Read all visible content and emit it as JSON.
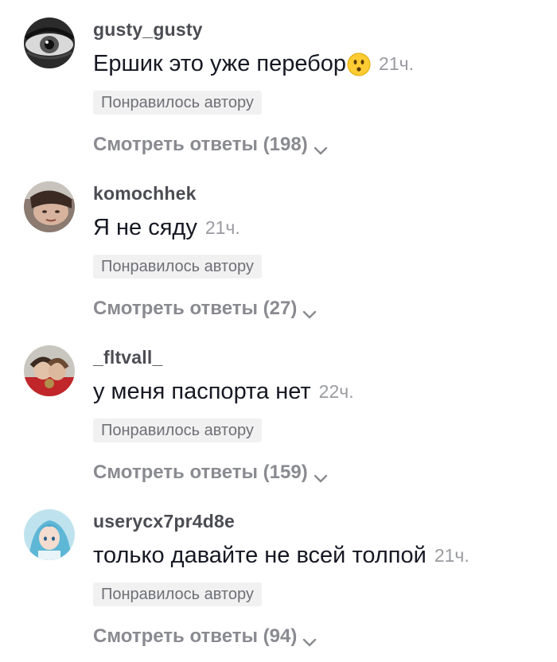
{
  "comments": [
    {
      "username": "gusty_gusty",
      "text": "Ершик это уже перебор",
      "emoji_icon": "hushed-face-emoji",
      "time": "21ч.",
      "liked_badge": "Понравилось автору",
      "view_replies": "Смотреть ответы (198)",
      "chevron_icon": "chevron-down-icon"
    },
    {
      "username": "komochhek",
      "text": "Я не сяду",
      "time": "21ч.",
      "liked_badge": "Понравилось автору",
      "view_replies": "Смотреть ответы (27)",
      "chevron_icon": "chevron-down-icon"
    },
    {
      "username": "_fltvall_",
      "text": "у меня паспорта нет",
      "time": "22ч.",
      "liked_badge": "Понравилось автору",
      "view_replies": "Смотреть ответы (159)",
      "chevron_icon": "chevron-down-icon"
    },
    {
      "username": "userycx7pr4d8e",
      "text": "только давайте не всей толпой",
      "time": "21ч.",
      "liked_badge": "Понравилось автору",
      "view_replies": "Смотреть ответы (94)",
      "chevron_icon": "chevron-down-icon"
    }
  ]
}
